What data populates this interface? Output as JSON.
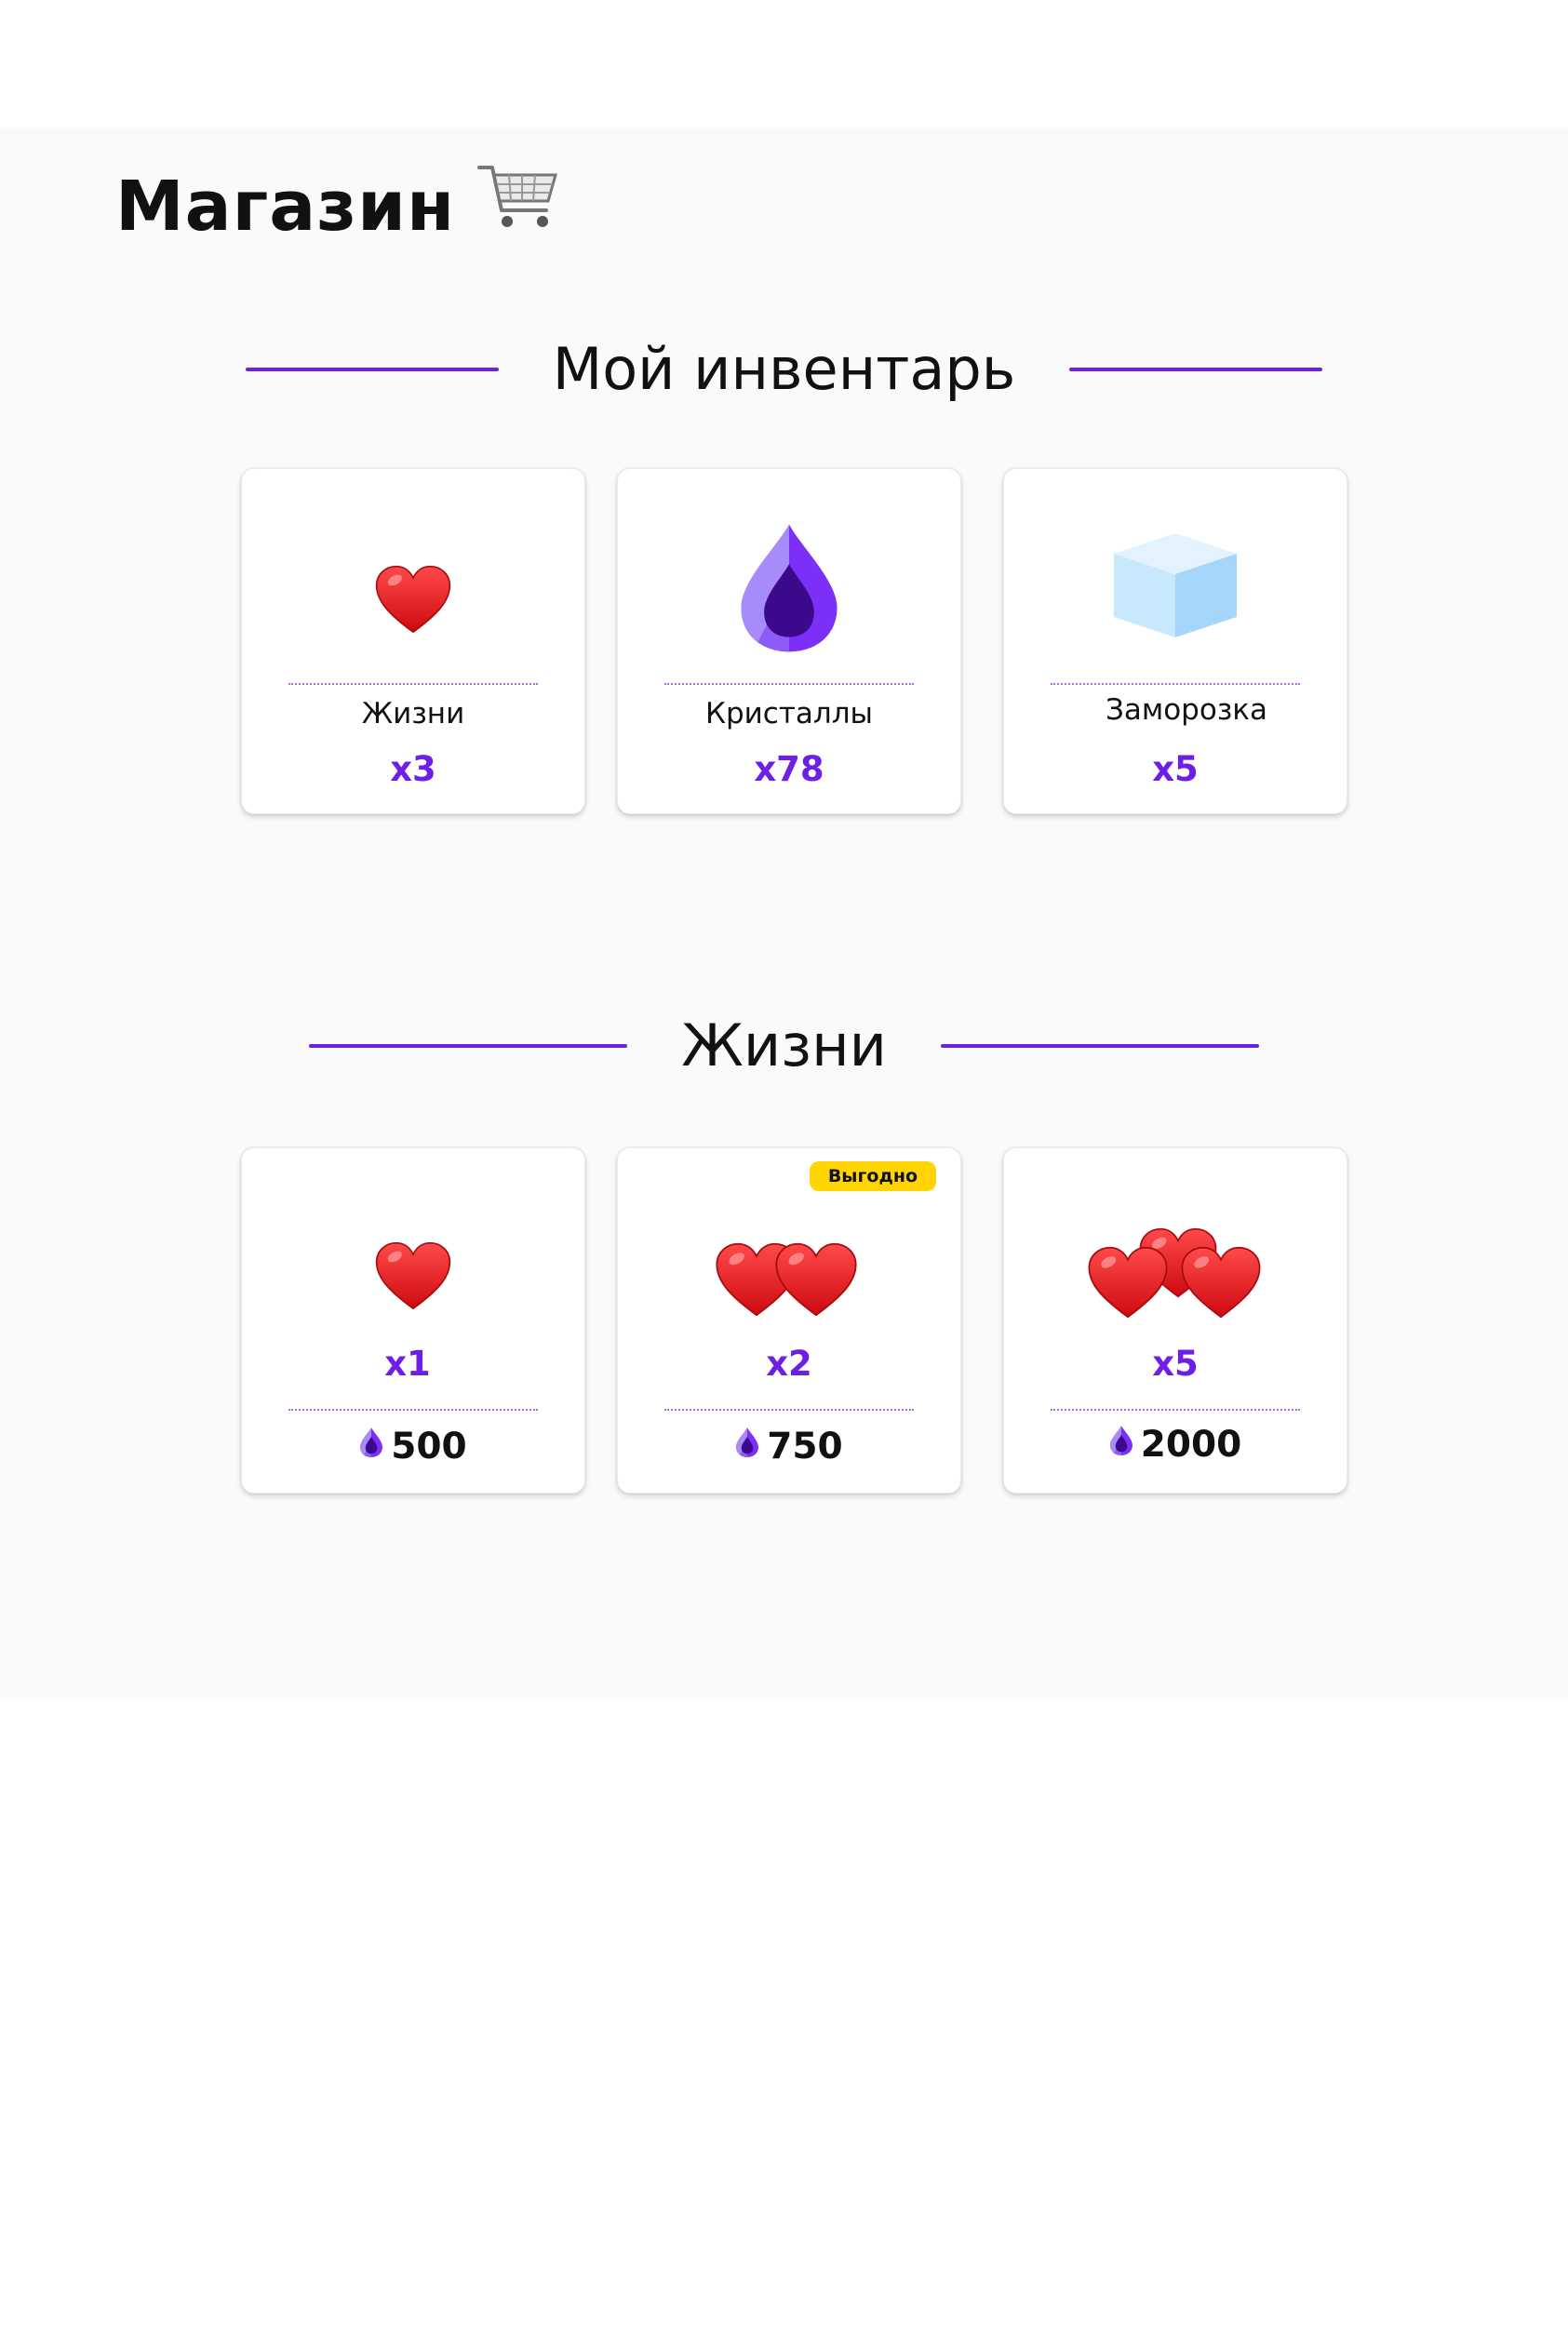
{
  "header": {
    "title": "Магазин",
    "cart_icon": "shopping-cart-icon"
  },
  "inventory": {
    "heading": "Мой инвентарь",
    "items": [
      {
        "icon": "heart-icon",
        "name": "Жизни",
        "count": "x3"
      },
      {
        "icon": "crystal-icon",
        "name": "Кристаллы",
        "count": "x78"
      },
      {
        "icon": "ice-cube-icon",
        "name": "Заморозка",
        "count": "x5"
      }
    ]
  },
  "lives_shop": {
    "heading": "Жизни",
    "items": [
      {
        "icon": "heart-icon",
        "count": "x1",
        "price": "500",
        "price_icon": "crystal-icon"
      },
      {
        "icon": "hearts-icon",
        "count": "x2",
        "price": "750",
        "price_icon": "crystal-icon",
        "badge": "Выгодно"
      },
      {
        "icon": "hearts-icon",
        "count": "x5",
        "price": "2000",
        "price_icon": "crystal-icon"
      }
    ]
  },
  "colors": {
    "accent": "#6d1fe6",
    "badge": "#ffd400",
    "heart": "#e8141e",
    "panel": "#fafafa"
  }
}
